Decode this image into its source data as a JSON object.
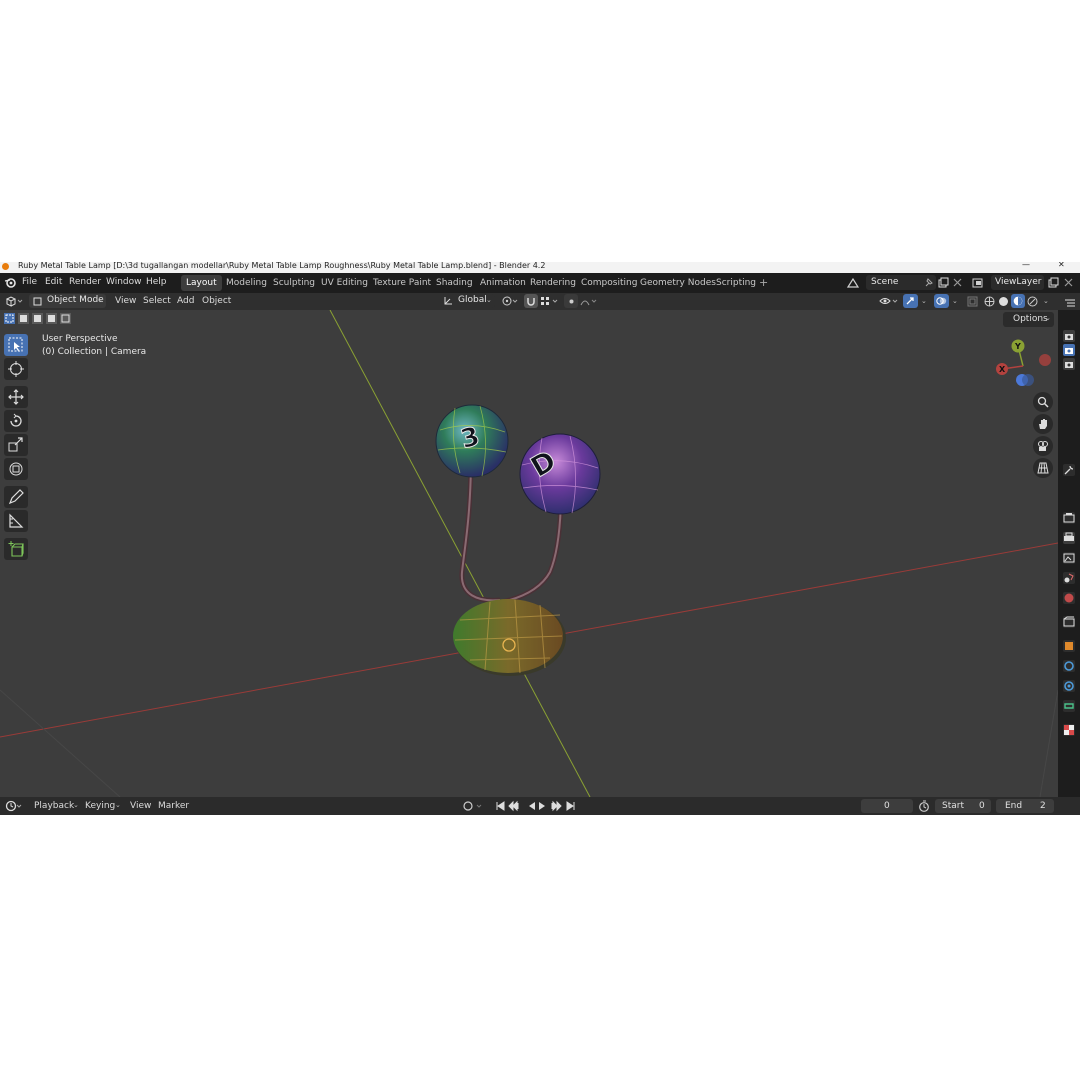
{
  "titlebar": {
    "text": "Ruby Metal Table Lamp [D:\\3d tugallangan modellar\\Ruby Metal Table Lamp Roughness\\Ruby Metal Table Lamp.blend] - Blender 4.2",
    "minimize": "—",
    "close": "✕"
  },
  "menu": {
    "file": "File",
    "edit": "Edit",
    "render": "Render",
    "window": "Window",
    "help": "Help"
  },
  "workspaces": [
    "Layout",
    "Modeling",
    "Sculpting",
    "UV Editing",
    "Texture Paint",
    "Shading",
    "Animation",
    "Rendering",
    "Compositing",
    "Geometry Nodes",
    "Scripting"
  ],
  "active_workspace": "Layout",
  "add_workspace": "+",
  "scene": {
    "label": "Scene",
    "viewlayer": "ViewLayer"
  },
  "header": {
    "mode": "Object Mode",
    "view": "View",
    "select": "Select",
    "add": "Add",
    "object": "Object",
    "transform_orientation": "Global",
    "options": "Options"
  },
  "viewport": {
    "perspective": "User Perspective",
    "collection": "(0) Collection | Camera",
    "gizmo": {
      "x": "X",
      "y": "Y"
    },
    "sphere_left_glyph": "3",
    "sphere_right_glyph": "D"
  },
  "timeline": {
    "playback": "Playback",
    "keying": "Keying",
    "view": "View",
    "marker": "Marker",
    "current_frame": "0",
    "start_label": "Start",
    "start_value": "0",
    "end_label": "End",
    "end_value": "2"
  },
  "colors": {
    "accent": "#4772b3",
    "x_axis": "#b3423e",
    "y_axis": "#8aa133",
    "z_axis": "#4c79d9",
    "viewport_bg": "#3d3d3d"
  }
}
